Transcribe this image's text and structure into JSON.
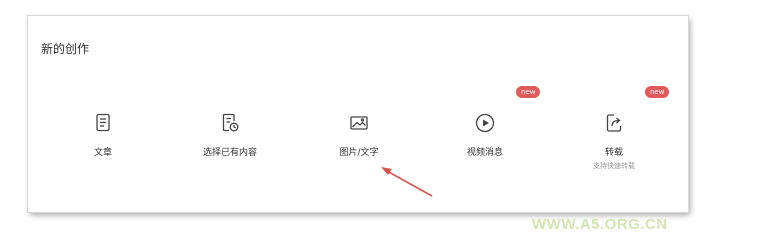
{
  "panel": {
    "title": "新的创作"
  },
  "items": [
    {
      "label": "文章",
      "icon": "document-icon"
    },
    {
      "label": "选择已有内容",
      "icon": "document-clock-icon"
    },
    {
      "label": "图片/文字",
      "icon": "image-icon"
    },
    {
      "label": "视频消息",
      "icon": "play-circle-icon",
      "badge": "new"
    },
    {
      "label": "转载",
      "sublabel": "支持快速转载",
      "icon": "share-icon",
      "badge": "new"
    }
  ],
  "watermark": "WWW.A5.ORG.CN",
  "colors": {
    "badge": "#e25a5a",
    "arrow": "#d9534f",
    "icon": "#444444"
  }
}
